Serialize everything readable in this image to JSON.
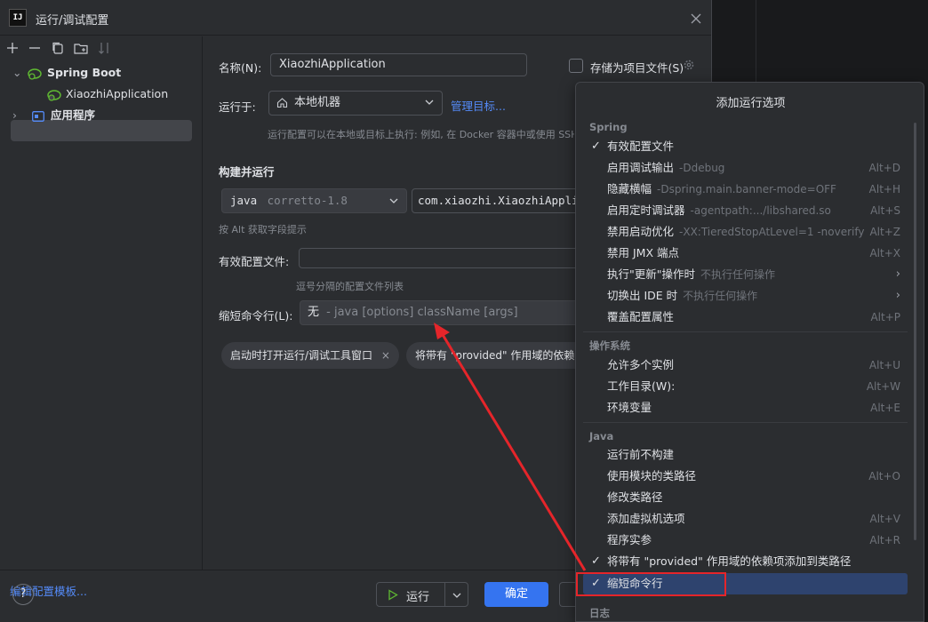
{
  "dialog": {
    "title": "运行/调试配置",
    "logo_text": "IJ"
  },
  "sidebar": {
    "spring_boot": "Spring Boot",
    "xiaozhi_app": "XiaozhiApplication",
    "application": "应用程序",
    "edit_templates": "编辑配置模板..."
  },
  "form": {
    "name_label": "名称(N):",
    "name_value": "XiaozhiApplication",
    "store_label": "存储为项目文件(S)",
    "run_on_label": "运行于:",
    "run_on_value": "本地机器",
    "manage_targets": "管理目标...",
    "run_on_hint": "运行配置可以在本地或目标上执行: 例如, 在 Docker 容器中或使用 SSH",
    "build_run_label": "构建并运行",
    "jdk_prefix": "java",
    "jdk_value": "corretto-1.8",
    "main_class": "com.xiaozhi.XiaozhiApplica",
    "alt_hint": "按 Alt 获取字段提示",
    "active_profiles_label": "有效配置文件:",
    "profiles_hint": "逗号分隔的配置文件列表",
    "shorten_label": "缩短命令行(L):",
    "shorten_value": "无",
    "shorten_desc": "- java [options] className [args]",
    "chip1": "启动时打开运行/调试工具窗口",
    "chip2": "将带有 \"provided\" 作用域的依赖"
  },
  "bottom": {
    "help": "?",
    "run": "运行",
    "ok": "确定"
  },
  "popup": {
    "title": "添加运行选项",
    "sections": {
      "spring": "Spring",
      "os": "操作系统",
      "java": "Java",
      "log": "日志"
    },
    "items": [
      {
        "label": "有效配置文件",
        "desc": "",
        "shortcut": "",
        "checked": true
      },
      {
        "label": "启用调试输出",
        "desc": "-Ddebug",
        "shortcut": "Alt+D"
      },
      {
        "label": "隐藏横幅",
        "desc": "-Dspring.main.banner-mode=OFF",
        "shortcut": "Alt+H"
      },
      {
        "label": "启用定时调试器",
        "desc": "-agentpath:.../libshared.so",
        "shortcut": "Alt+S"
      },
      {
        "label": "禁用启动优化",
        "desc": "-XX:TieredStopAtLevel=1 -noverify",
        "shortcut": "Alt+Z"
      },
      {
        "label": "禁用 JMX 端点",
        "desc": "",
        "shortcut": "Alt+X"
      },
      {
        "label": "执行\"更新\"操作时",
        "desc": "不执行任何操作",
        "shortcut": "",
        "submenu": true
      },
      {
        "label": "切换出 IDE 时",
        "desc": "不执行任何操作",
        "shortcut": "",
        "submenu": true
      },
      {
        "label": "覆盖配置属性",
        "desc": "",
        "shortcut": "Alt+P"
      },
      {
        "label": "允许多个实例",
        "desc": "",
        "shortcut": "Alt+U"
      },
      {
        "label": "工作目录(W):",
        "desc": "",
        "shortcut": "Alt+W"
      },
      {
        "label": "环境变量",
        "desc": "",
        "shortcut": "Alt+E"
      },
      {
        "label": "运行前不构建",
        "desc": "",
        "shortcut": ""
      },
      {
        "label": "使用模块的类路径",
        "desc": "",
        "shortcut": "Alt+O"
      },
      {
        "label": "修改类路径",
        "desc": "",
        "shortcut": ""
      },
      {
        "label": "添加虚拟机选项",
        "desc": "",
        "shortcut": "Alt+V"
      },
      {
        "label": "程序实参",
        "desc": "",
        "shortcut": "Alt+R"
      },
      {
        "label": "将带有 \"provided\" 作用域的依赖项添加到类路径",
        "desc": "",
        "shortcut": "",
        "checked": true
      },
      {
        "label": "缩短命令行",
        "desc": "",
        "shortcut": "",
        "checked": true,
        "selected": true
      }
    ]
  },
  "colors": {
    "accent": "#3574f0",
    "link": "#548af7",
    "annotation_red": "#e5252a",
    "selection": "#2e436e"
  }
}
